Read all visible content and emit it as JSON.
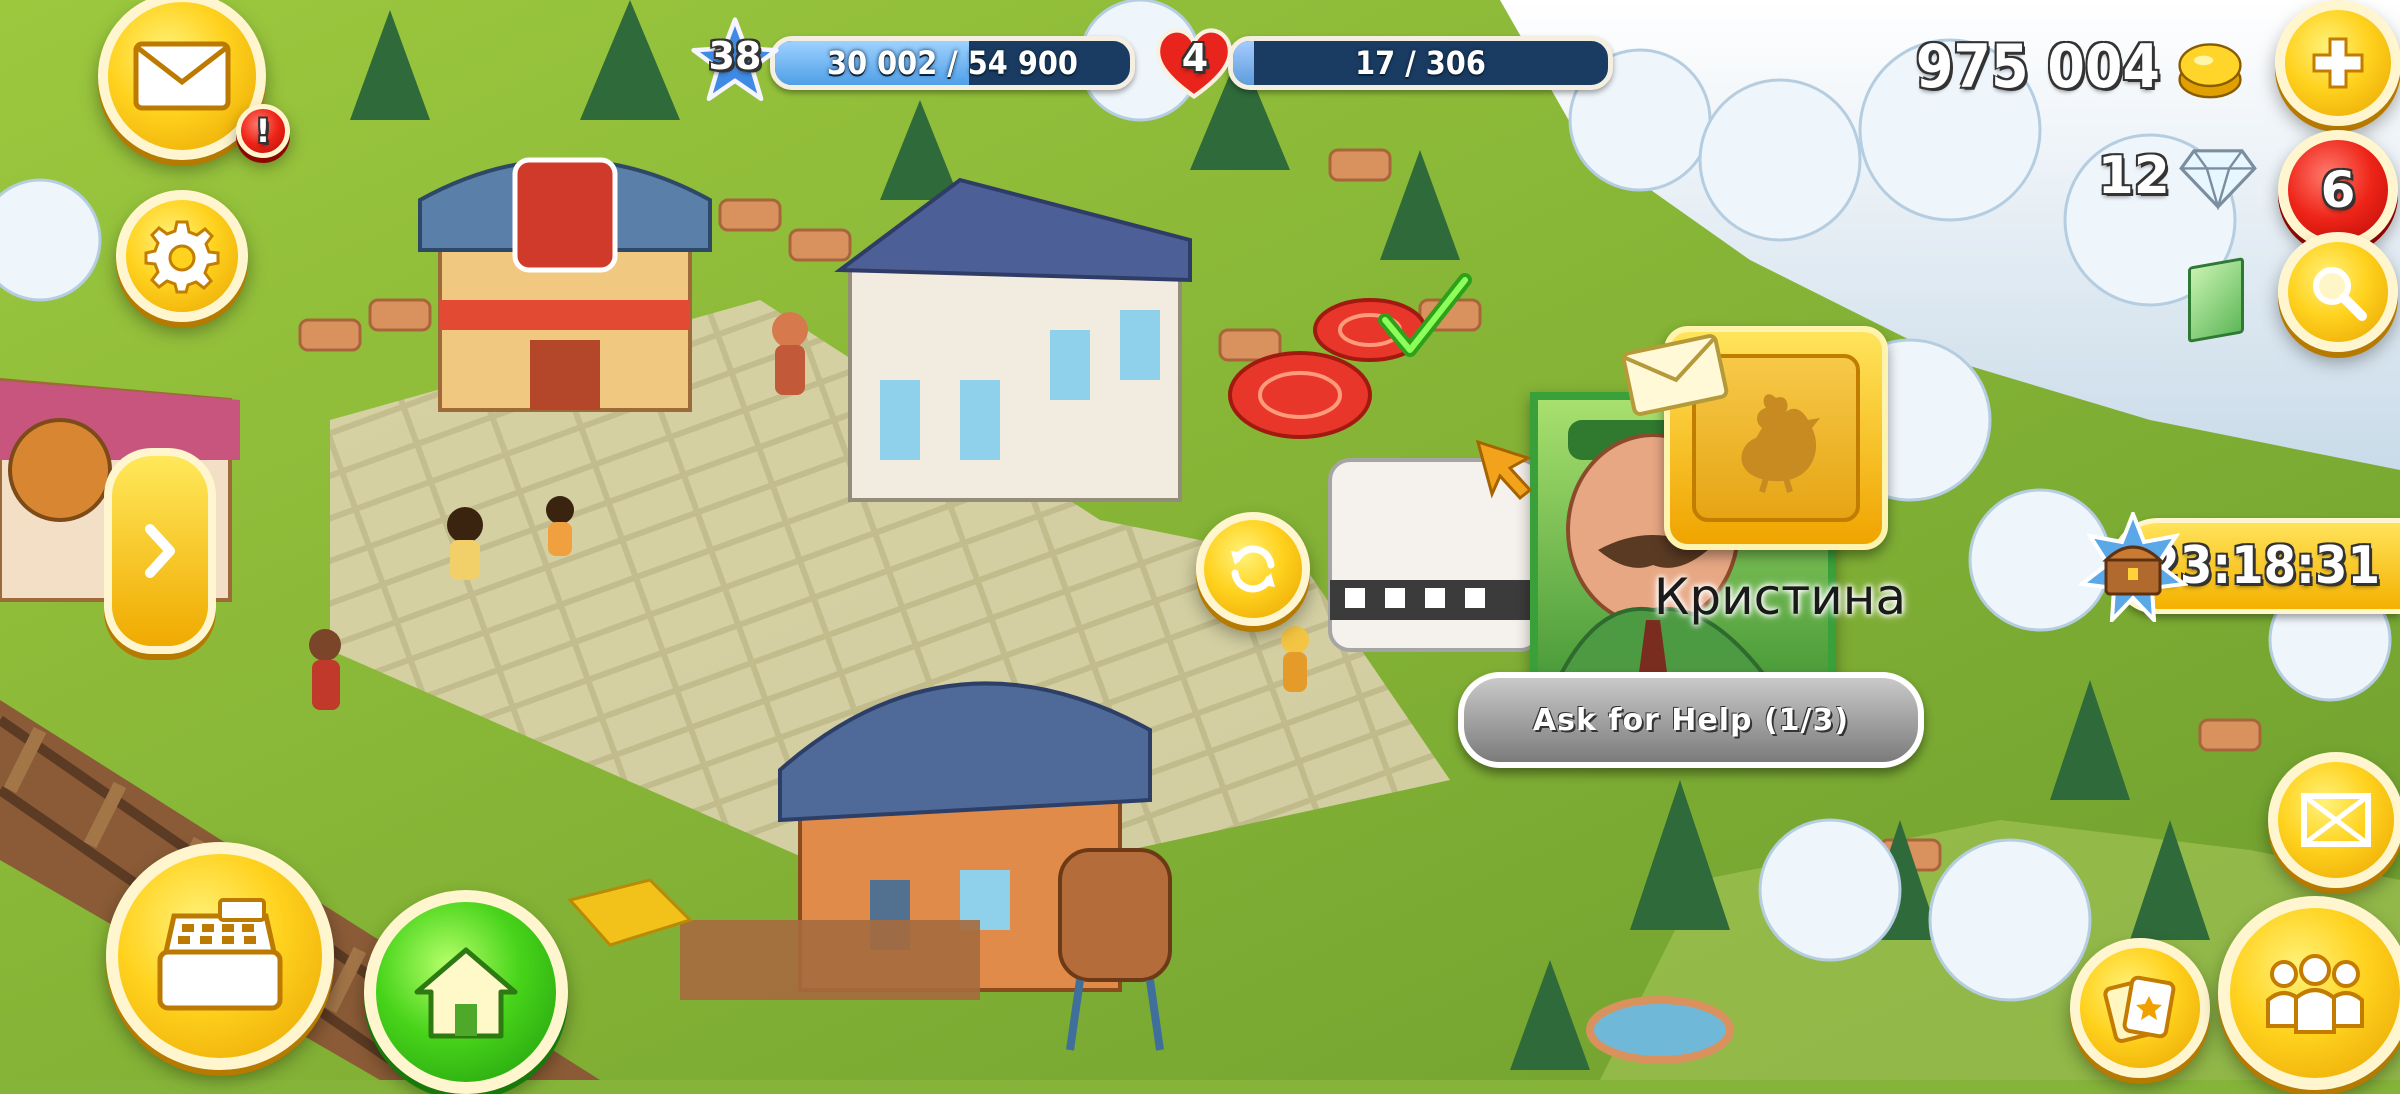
{
  "hud": {
    "level": "38",
    "xp_text": "30 002 / 54 900",
    "xp_progress": 0.546,
    "reputation_level": "4",
    "reputation_text": "17 / 306",
    "reputation_progress": 0.056,
    "coins": "975 004",
    "diamonds": "12",
    "news_badge": "6",
    "mail_alert": "!",
    "timer": "23:18:31"
  },
  "helper_popup": {
    "name": "Кристина",
    "ask_button": "Ask for Help (1/3)"
  },
  "icons": {
    "mail": "envelope-icon",
    "settings": "gear-icon",
    "side_menu": "chevron-right-icon",
    "refresh": "refresh-icon",
    "add_currency": "plus-icon",
    "search": "magnifier-icon",
    "shop": "cash-register-icon",
    "home": "house-icon",
    "zoom": "expand-icon",
    "cards": "cards-icon",
    "friends": "friends-icon",
    "chest": "treasure-chest-icon",
    "chicken": "chicken-icon",
    "check": "checkmark-icon",
    "tomato": "tomato-icon"
  },
  "colors": {
    "gold": "#ffd21e",
    "xp_fill": "#69b8ff",
    "reputation_fill": "#5d9ddc",
    "grass": "#86b43a",
    "snow": "#e7f1f8",
    "green_button": "#48d41a",
    "red_badge": "#ee2418"
  }
}
